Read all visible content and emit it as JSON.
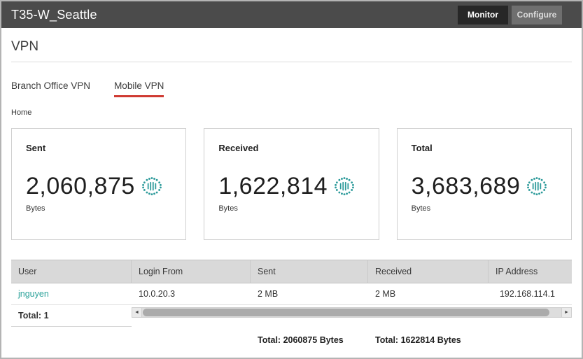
{
  "header": {
    "title": "T35-W_Seattle",
    "monitor_label": "Monitor",
    "configure_label": "Configure"
  },
  "page": {
    "title": "VPN",
    "breadcrumb": "Home"
  },
  "tabs": [
    {
      "label": "Branch Office VPN",
      "active": false
    },
    {
      "label": "Mobile VPN",
      "active": true
    }
  ],
  "cards": [
    {
      "label": "Sent",
      "value": "2,060,875",
      "unit": "Bytes"
    },
    {
      "label": "Received",
      "value": "1,622,814",
      "unit": "Bytes"
    },
    {
      "label": "Total",
      "value": "3,683,689",
      "unit": "Bytes"
    }
  ],
  "table": {
    "columns": [
      "User",
      "Login From",
      "Sent",
      "Received",
      "IP Address"
    ],
    "rows": [
      {
        "user": "jnguyen",
        "login_from": "10.0.20.3",
        "sent": "2 MB",
        "received": "2 MB",
        "ip": "192.168.114.1"
      }
    ],
    "user_total": "Total: 1",
    "sent_total": "Total: 2060875 Bytes",
    "received_total": "Total: 1622814 Bytes"
  },
  "icons": {
    "scroll_left": "◄",
    "scroll_right": "►",
    "mobile_vpn_icon": "dotted-circle-signal"
  },
  "colors": {
    "accent_teal": "#2e9b9b",
    "tab_underline": "#cf3a32",
    "topbar": "#4b4b4b"
  }
}
